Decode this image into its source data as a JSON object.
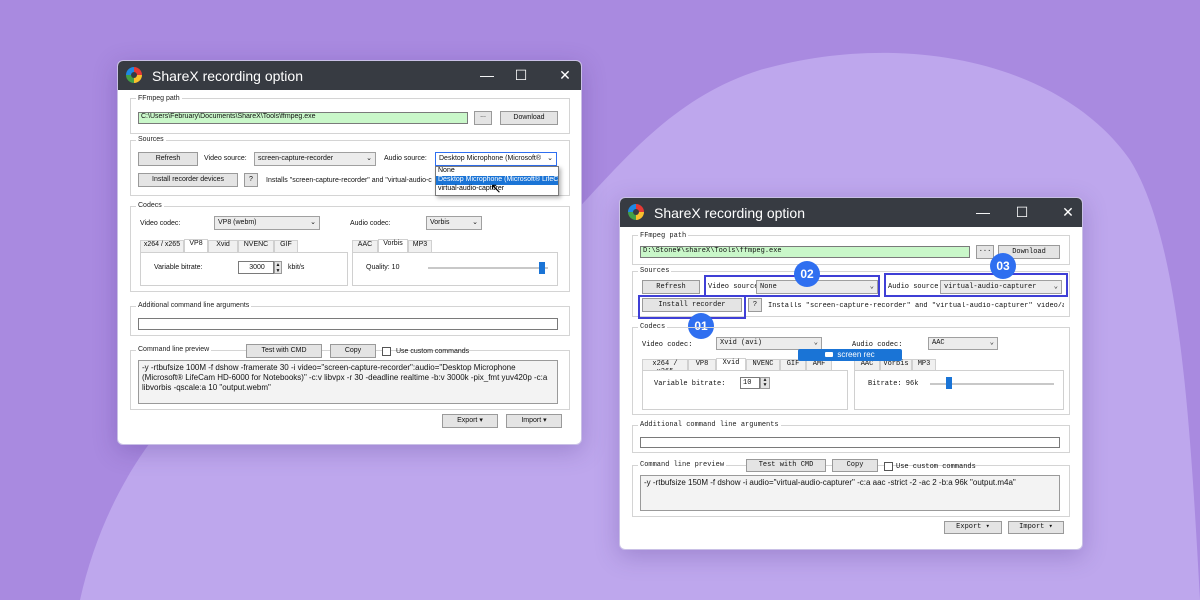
{
  "background": {
    "color": "#a98ae0",
    "blob": "#c3aef0"
  },
  "window1": {
    "title": "ShareX recording option",
    "ffmpeg": {
      "label": "FFmpeg path",
      "path": "C:\\Users\\February\\Documents\\ShareX\\Tools\\ffmpeg.exe",
      "browse": "...",
      "download": "Download"
    },
    "sources": {
      "label": "Sources",
      "refresh": "Refresh",
      "video_label": "Video source:",
      "video_value": "screen-capture-recorder",
      "audio_label": "Audio source:",
      "audio_value": "Desktop Microphone (Microsoft®",
      "install": "Install recorder devices",
      "help": "?",
      "install_note": "Installs \"screen-capture-recorder\" and \"virtual-audio-c",
      "dropdown": [
        "None",
        "Desktop Microphone (Microsoft® LifeC",
        "virtual-audio-capturer"
      ]
    },
    "codecs": {
      "label": "Codecs",
      "video_label": "Video codec:",
      "video_value": "VP8 (webm)",
      "audio_label": "Audio codec:",
      "audio_value": "Vorbis",
      "video_tabs": [
        "x264 / x265",
        "VP8",
        "Xvid",
        "NVENC",
        "GIF"
      ],
      "bitrate_label": "Variable bitrate:",
      "bitrate_value": "3000",
      "bitrate_unit": "kbit/s",
      "audio_tabs": [
        "AAC",
        "Vorbis",
        "MP3"
      ],
      "quality_label": "Quality: 10",
      "quality_level": 0.95
    },
    "args": {
      "label": "Additional command line arguments",
      "value": ""
    },
    "preview": {
      "label": "Command line preview",
      "test": "Test with CMD",
      "copy": "Copy",
      "custom": "Use custom commands",
      "text": "-y -rtbufsize 100M -f dshow -framerate 30 -i video=\"screen-capture-recorder\":audio=\"Desktop Microphone (Microsoft® LifeCam HD-6000 for Notebooks)\" -c:v libvpx -r 30 -deadline realtime -b:v 3000k -pix_fmt yuv420p -c:a libvorbis -qscale:a 10 \"output.webm\""
    },
    "export": "Export",
    "import": "Import"
  },
  "window2": {
    "title": "ShareX recording option",
    "ffmpeg": {
      "label": "FFmpeg path",
      "path": "D:\\Stone¥\\shareX\\Tools\\ffmpeg.exe",
      "browse": "...",
      "download": "Download"
    },
    "sources": {
      "label": "Sources",
      "refresh": "Refresh",
      "video_label": "Video source:",
      "video_value": "None",
      "audio_label": "Audio source:",
      "audio_value": "virtual-audio-capturer",
      "install": "Install recorder",
      "help": "?",
      "install_note": "Installs \"screen-capture-recorder\" and \"virtual-audio-capturer\" video/audi"
    },
    "codecs": {
      "label": "Codecs",
      "video_label": "Video codec:",
      "video_value": "Xvid (avi)",
      "audio_label": "Audio codec:",
      "audio_value": "AAC",
      "video_tabs": [
        "x264 / x265",
        "VP8",
        "Xvid",
        "NVENC",
        "GIF",
        "AMF"
      ],
      "bitrate_label": "Variable bitrate:",
      "bitrate_value": "10",
      "audio_tabs": [
        "AAC",
        "Vorbis",
        "MP3"
      ],
      "audio_bitrate_label": "Bitrate: 96k",
      "audio_level": 0.15
    },
    "args": {
      "label": "Additional command line arguments",
      "value": ""
    },
    "preview": {
      "label": "Command line preview",
      "test": "Test with CMD",
      "copy": "Copy",
      "custom": "Use custom commands",
      "text": "-y -rtbufsize 150M -f dshow -i audio=\"virtual-audio-capturer\" -c:a aac -strict -2 -ac 2 -b:a 96k \"output.m4a\""
    },
    "export": "Export",
    "import": "Import",
    "watermark": "screen rec",
    "badges": [
      "02",
      "03",
      "01"
    ]
  }
}
